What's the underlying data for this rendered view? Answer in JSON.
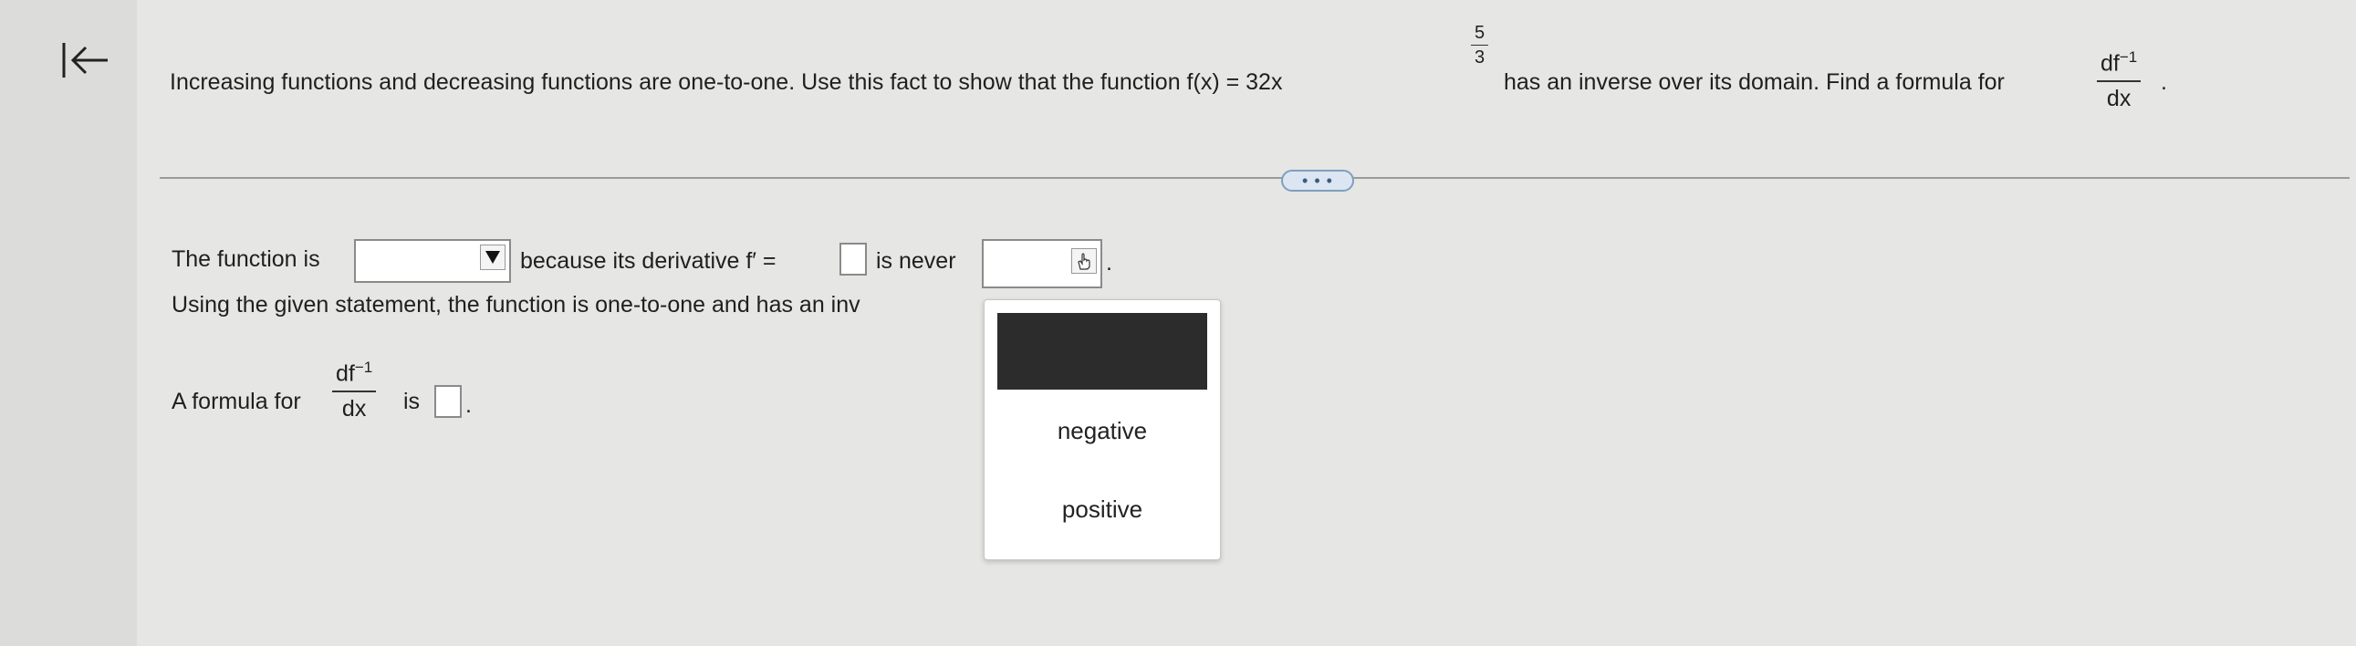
{
  "nav": {
    "back_icon": "collapse-left-icon"
  },
  "question": {
    "part1": "Increasing functions and decreasing functions are one-to-one. Use this fact to show that the function f(x) = 32x",
    "exponent_num": "5",
    "exponent_den": "3",
    "part2": "has an inverse over its domain. Find a formula for",
    "deriv_num_base": "df",
    "deriv_num_sup": "−1",
    "deriv_den": "dx",
    "end_punct": "."
  },
  "more_button_label": "• • •",
  "answer": {
    "line1_a": "The function is",
    "line1_b": "because its derivative f′ =",
    "line1_c": "is never",
    "line1_end": ".",
    "line2": "Using the given statement, the function is one-to-one and has an inv",
    "formula_prefix": "A formula for",
    "formula_num_base": "df",
    "formula_num_sup": "−1",
    "formula_den": "dx",
    "formula_is": "is",
    "formula_end": "."
  },
  "dropdown": {
    "options": [
      "negative",
      "positive"
    ]
  },
  "colors": {
    "background": "#e6e6e4",
    "highlight": "#2c2c2c",
    "more_button": "#7f9fbf"
  }
}
